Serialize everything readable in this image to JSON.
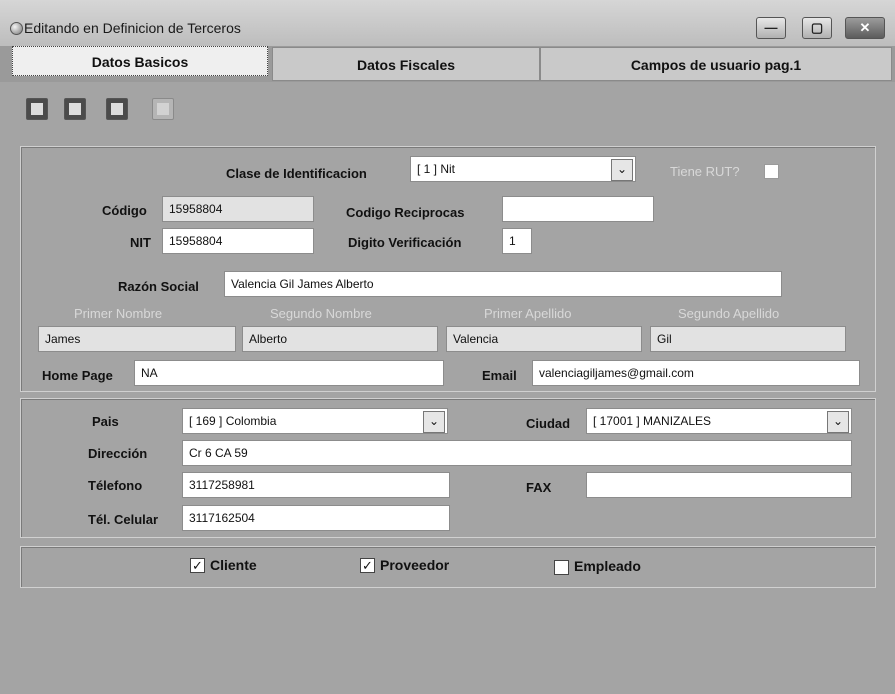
{
  "window": {
    "title": "Editando en Definicion de Terceros",
    "minimize_glyph": "—",
    "maximize_glyph": "▢",
    "close_glyph": "✕"
  },
  "tabs": [
    {
      "label": "Datos Basicos",
      "active": true
    },
    {
      "label": "Datos Fiscales",
      "active": false
    },
    {
      "label": "Campos de usuario pag.1",
      "active": false
    }
  ],
  "toolbar": {
    "icons": [
      "save-icon",
      "print-icon",
      "exit-icon",
      "copy-icon"
    ]
  },
  "identificacion": {
    "clase_label": "Clase de Identificacion",
    "clase_value": "[ 1 ] Nit",
    "tiene_rut_label": "Tiene RUT?",
    "codigo_label": "Código",
    "codigo_value": "15958804",
    "codigo_reciprocas_label": "Codigo Reciprocas",
    "codigo_reciprocas_value": "",
    "nit_label": "NIT",
    "nit_value": "15958804",
    "digito_label": "Digito  Verificación",
    "digito_value": "1",
    "razon_label": "Razón Social",
    "razon_value": "Valencia Gil James Alberto",
    "primer_nombre_label": "Primer Nombre",
    "primer_nombre_value": "James",
    "segundo_nombre_label": "Segundo Nombre",
    "segundo_nombre_value": "Alberto",
    "primer_apellido_label": "Primer Apellido",
    "primer_apellido_value": "Valencia",
    "segundo_apellido_label": "Segundo Apellido",
    "segundo_apellido_value": "Gil",
    "home_label": "Home Page",
    "home_value": "NA",
    "email_label": "Email",
    "email_value": "valenciagiljames@gmail.com"
  },
  "ubicacion": {
    "pais_label": "Pais",
    "pais_value": "[ 169 ] Colombia",
    "ciudad_label": "Ciudad",
    "ciudad_value": "[ 17001 ] MANIZALES",
    "direccion_label": "Dirección",
    "direccion_value": "Cr 6 CA 59",
    "telefono_label": "Télefono",
    "telefono_value": "3117258981",
    "fax_label": "FAX",
    "fax_value": "",
    "celular_label": "Tél. Celular",
    "celular_value": "3117162504"
  },
  "tipos": {
    "cliente_label": "Cliente",
    "cliente_checked": true,
    "proveedor_label": "Proveedor",
    "proveedor_checked": true,
    "empleado_label": "Empleado",
    "empleado_checked": false,
    "check_glyph": "✓"
  }
}
